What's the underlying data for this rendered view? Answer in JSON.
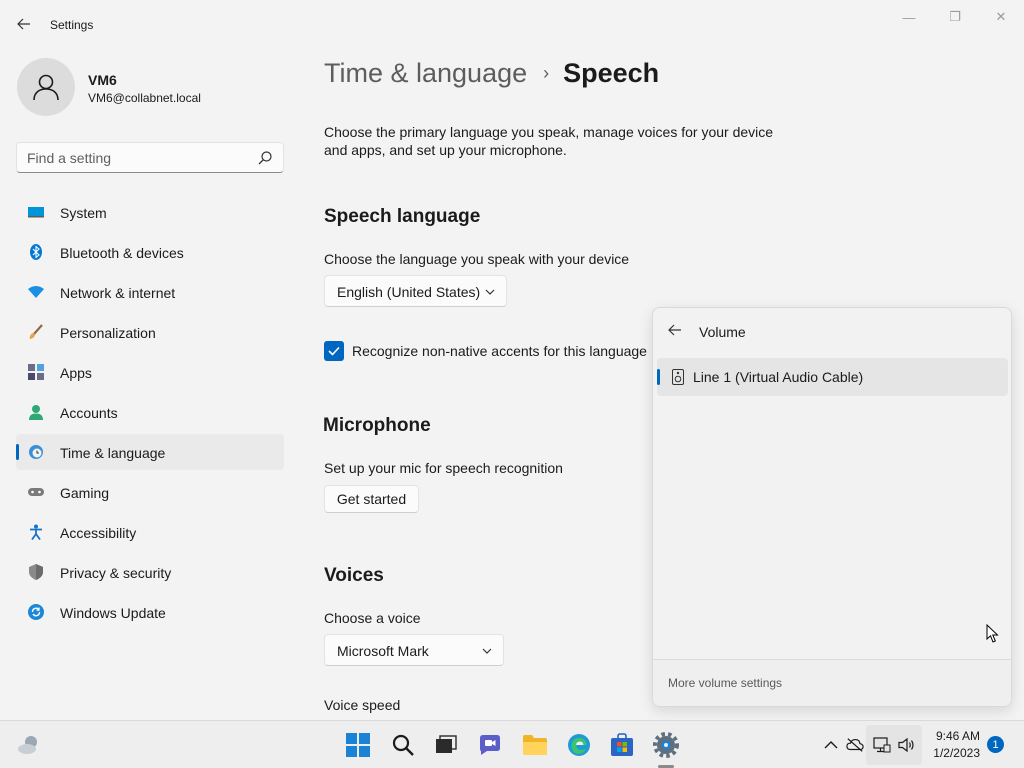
{
  "window": {
    "title": "Settings",
    "minimize_icon": "—",
    "maximize_icon": "❐",
    "close_icon": "✕"
  },
  "profile": {
    "name": "VM6",
    "email": "VM6@collabnet.local"
  },
  "search": {
    "placeholder": "Find a setting"
  },
  "nav": {
    "items": [
      {
        "label": "System",
        "icon": "system-icon"
      },
      {
        "label": "Bluetooth & devices",
        "icon": "bluetooth-icon"
      },
      {
        "label": "Network & internet",
        "icon": "network-icon"
      },
      {
        "label": "Personalization",
        "icon": "brush-icon"
      },
      {
        "label": "Apps",
        "icon": "apps-icon"
      },
      {
        "label": "Accounts",
        "icon": "accounts-icon"
      },
      {
        "label": "Time & language",
        "icon": "time-language-icon",
        "selected": true
      },
      {
        "label": "Gaming",
        "icon": "gaming-icon"
      },
      {
        "label": "Accessibility",
        "icon": "accessibility-icon"
      },
      {
        "label": "Privacy & security",
        "icon": "shield-icon"
      },
      {
        "label": "Windows Update",
        "icon": "update-icon"
      }
    ]
  },
  "page": {
    "breadcrumb_parent": "Time & language",
    "breadcrumb_separator": "›",
    "breadcrumb_current": "Speech",
    "description": "Choose the primary language you speak, manage voices for your device and apps, and set up your microphone."
  },
  "speech_language": {
    "title": "Speech language",
    "prompt": "Choose the language you speak with your device",
    "selected_language": "English (United States)",
    "accent_checkbox_label": "Recognize non-native accents for this language",
    "accent_checked": true
  },
  "microphone": {
    "title": "Microphone",
    "prompt": "Set up your mic for speech recognition",
    "button_label": "Get started"
  },
  "voices": {
    "title": "Voices",
    "prompt": "Choose a voice",
    "selected_voice": "Microsoft Mark",
    "speed_label": "Voice speed"
  },
  "volume_flyout": {
    "title": "Volume",
    "device": "Line 1 (Virtual Audio Cable)",
    "footer_link": "More volume settings"
  },
  "taskbar": {
    "time": "9:46 AM",
    "date": "1/2/2023",
    "notification_count": "1"
  },
  "colors": {
    "accent": "#0067c0",
    "background": "#f3f3f3",
    "selected_nav": "#eaeaea"
  }
}
